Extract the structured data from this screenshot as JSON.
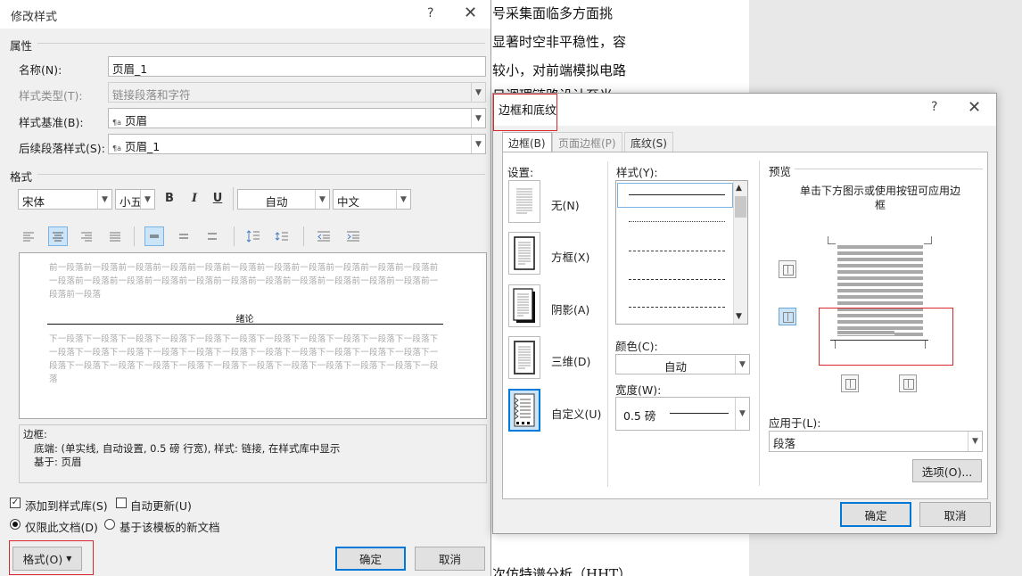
{
  "background_doc": {
    "lines": [
      "号采集面临多方面挑",
      "显著时空非平稳性，容",
      "较小，对前端模拟电路",
      "日调理链路设计至光",
      "次仿特谱分析（HHT）"
    ]
  },
  "modify_style": {
    "title": "修改样式",
    "help": "?",
    "close": "✕",
    "properties_label": "属性",
    "name_label": "名称(N):",
    "name_value": "页眉_1",
    "style_type_label": "样式类型(T):",
    "style_type_value": "链接段落和字符",
    "based_on_label": "样式基准(B):",
    "based_on_value": "页眉",
    "following_label": "后续段落样式(S):",
    "following_value": "页眉_1",
    "style_glyph": "¶a",
    "format_label": "格式",
    "font": "宋体",
    "size": "小五",
    "bold": "B",
    "italic": "I",
    "underline": "U",
    "color": "自动",
    "script": "中文",
    "preview_prev": "前一段落前一段落前一段落前一段落前一段落前一段落前一段落前一段落前一段落前一段落前一段落前一段落前一段落前一段落前一段落前一段落前一段落前一段落前一段落前一段落前一段落前一段落前一段落前一段落",
    "preview_sample": "绪论",
    "preview_next": "下一段落下一段落下一段落下一段落下一段落下一段落下一段落下一段落下一段落下一段落下一段落下一段落下一段落下一段落下一段落下一段落下一段落下一段落下一段落下一段落下一段落下一段落下一段落下一段落下一段落下一段落下一段落下一段落下一段落下一段落下一段落下一段落下一段落下一段落",
    "desc_line1": "边框:",
    "desc_line2": "底端: (单实线, 自动设置,  0.5 磅 行宽), 样式: 链接, 在样式库中显示",
    "desc_line3": "基于: 页眉",
    "add_gallery": "添加到样式库(S)",
    "auto_update": "自动更新(U)",
    "only_doc": "仅限此文档(D)",
    "new_docs": "基于该模板的新文档",
    "format_btn": "格式(O)",
    "ok": "确定",
    "cancel": "取消"
  },
  "borders": {
    "title": "边框和底纹",
    "help": "?",
    "close": "✕",
    "tabs": [
      "边框(B)",
      "页面边框(P)",
      "底纹(S)"
    ],
    "setting_label": "设置:",
    "settings": [
      "无(N)",
      "方框(X)",
      "阴影(A)",
      "三维(D)",
      "自定义(U)"
    ],
    "style_label": "样式(Y):",
    "color_label": "颜色(C):",
    "color_value": "自动",
    "width_label": "宽度(W):",
    "width_value": "0.5 磅",
    "preview_label": "预览",
    "preview_hint": "单击下方图示或使用按钮可应用边框",
    "apply_label": "应用于(L):",
    "apply_value": "段落",
    "options_btn": "选项(O)...",
    "ok": "确定",
    "cancel": "取消"
  },
  "colors": {
    "accent": "#0078d7",
    "highlight": "#d9262f"
  }
}
